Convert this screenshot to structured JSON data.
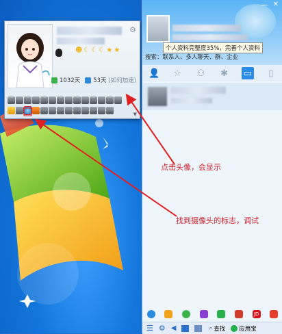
{
  "popup": {
    "online_days": "1032天",
    "active_days": "53天",
    "speedup_link": "(如何加速)"
  },
  "qq": {
    "tooltip": "个人资料完整度35%，完善个人资料",
    "search_text": "搜索：联系人、多人聊天、群、企业",
    "find_label": "查找",
    "appstore_label": "应用宝"
  },
  "annotations": {
    "click_avatar": "点击头像，会显示",
    "find_camera": "找到摄像头的标志，调试"
  },
  "colors": {
    "annotation": "#d0202a",
    "accent": "#2a8ce8"
  }
}
